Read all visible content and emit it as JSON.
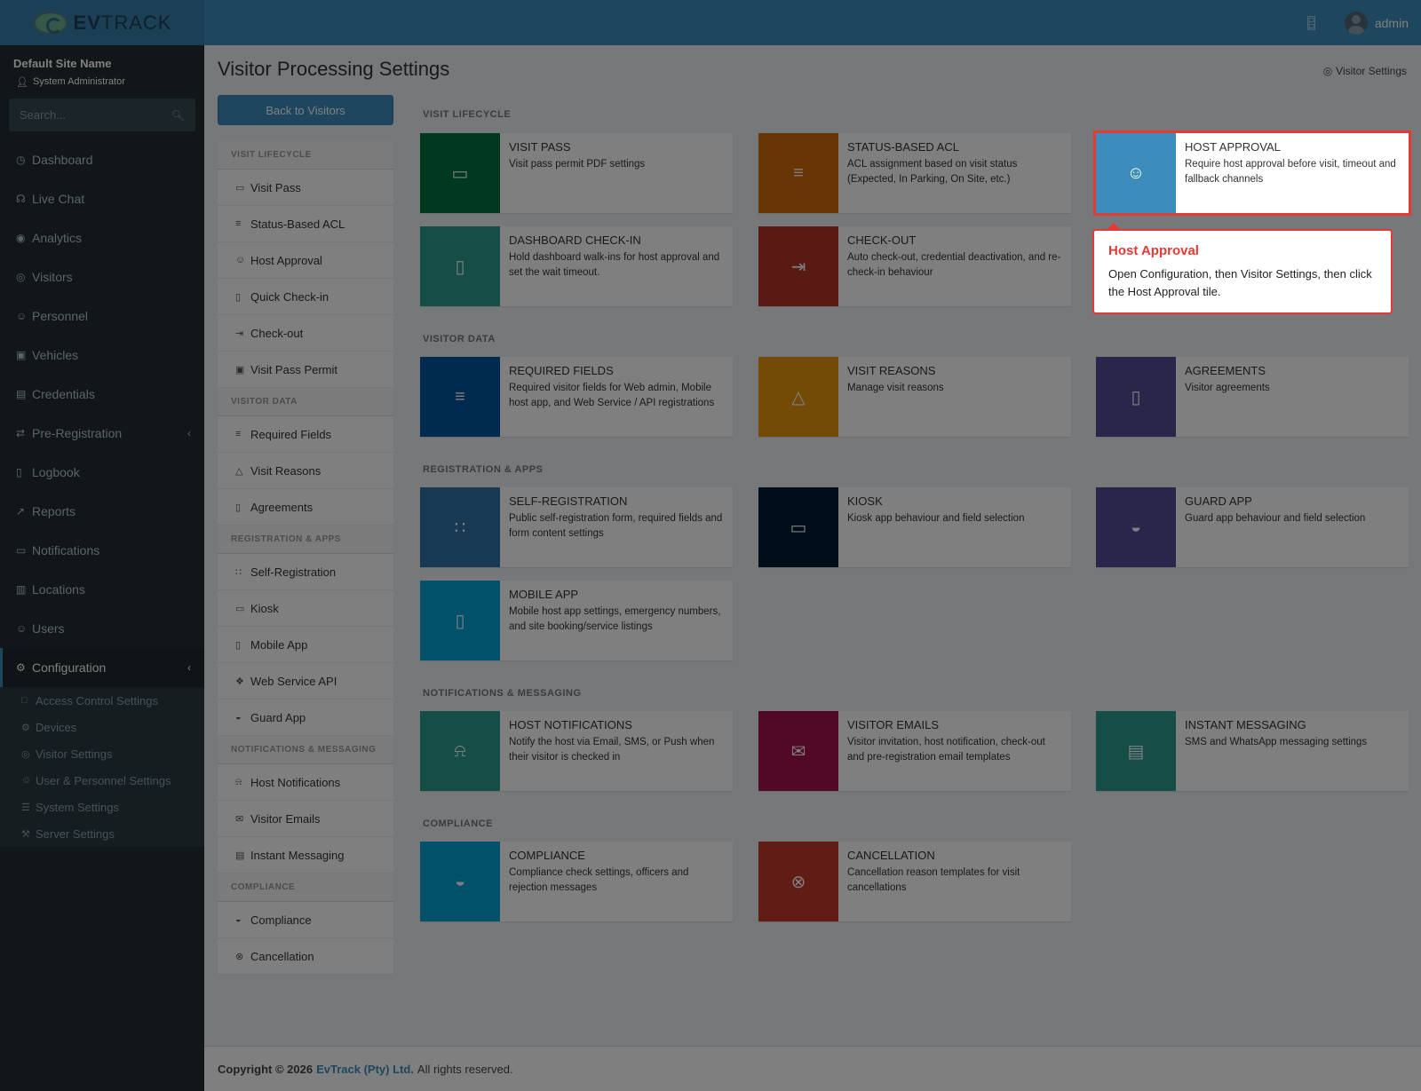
{
  "brand": {
    "logo_text_bold": "EV",
    "logo_text": "TRACK"
  },
  "topbar": {
    "user": "admin",
    "icon_door": "door-icon"
  },
  "sidebar": {
    "site_name": "Default Site Name",
    "role": "System Administrator",
    "search_placeholder": "Search...",
    "items": [
      {
        "label": "Dashboard"
      },
      {
        "label": "Live Chat"
      },
      {
        "label": "Analytics"
      },
      {
        "label": "Visitors"
      },
      {
        "label": "Personnel"
      },
      {
        "label": "Vehicles"
      },
      {
        "label": "Credentials"
      },
      {
        "label": "Pre-Registration"
      },
      {
        "label": "Logbook"
      },
      {
        "label": "Reports"
      },
      {
        "label": "Notifications"
      },
      {
        "label": "Locations"
      },
      {
        "label": "Users"
      },
      {
        "label": "Configuration"
      }
    ],
    "config_sub": [
      {
        "label": "Access Control Settings"
      },
      {
        "label": "Devices"
      },
      {
        "label": "Visitor Settings"
      },
      {
        "label": "User & Personnel Settings"
      },
      {
        "label": "System Settings"
      },
      {
        "label": "Server Settings"
      }
    ]
  },
  "page": {
    "title": "Visitor Processing Settings",
    "breadcrumb": "Visitor Settings",
    "back_button": "Back to Visitors"
  },
  "leftnav": {
    "sections": [
      {
        "title": "VISIT LIFECYCLE",
        "items": [
          "Visit Pass",
          "Status-Based ACL",
          "Host Approval",
          "Quick Check-in",
          "Check-out",
          "Visit Pass Permit"
        ]
      },
      {
        "title": "VISITOR DATA",
        "items": [
          "Required Fields",
          "Visit Reasons",
          "Agreements"
        ]
      },
      {
        "title": "REGISTRATION & APPS",
        "items": [
          "Self-Registration",
          "Kiosk",
          "Mobile App",
          "Web Service API",
          "Guard App"
        ]
      },
      {
        "title": "NOTIFICATIONS & MESSAGING",
        "items": [
          "Host Notifications",
          "Visitor Emails",
          "Instant Messaging"
        ]
      },
      {
        "title": "COMPLIANCE",
        "items": [
          "Compliance",
          "Cancellation"
        ]
      }
    ]
  },
  "sections": {
    "lifecycle": "VISIT LIFECYCLE",
    "data": "VISITOR DATA",
    "apps": "REGISTRATION & APPS",
    "notif": "NOTIFICATIONS & MESSAGING",
    "compliance": "COMPLIANCE"
  },
  "tiles": {
    "visit_pass": {
      "title": "VISIT PASS",
      "desc": "Visit pass permit PDF settings",
      "color": "#00733e"
    },
    "status_acl": {
      "title": "STATUS-BASED ACL",
      "desc": "ACL assignment based on visit status (Expected, In Parking, On Site, etc.)",
      "color": "#d26a0b"
    },
    "host_approval": {
      "title": "HOST APPROVAL",
      "desc": "Require host approval before visit, timeout and fallback channels",
      "color": "#3c8dbc"
    },
    "dash_checkin": {
      "title": "DASHBOARD CHECK-IN",
      "desc": "Hold dashboard walk-ins for host approval and set the wait timeout.",
      "color": "#2a9d8f"
    },
    "checkout": {
      "title": "CHECK-OUT",
      "desc": "Auto check-out, credential deactivation, and re-check-in behaviour",
      "color": "#b33427"
    },
    "required_fields": {
      "title": "REQUIRED FIELDS",
      "desc": "Required visitor fields for Web admin, Mobile host app, and Web Service / API registrations",
      "color": "#00569c"
    },
    "visit_reasons": {
      "title": "VISIT REASONS",
      "desc": "Manage visit reasons",
      "color": "#e6960e"
    },
    "agreements": {
      "title": "AGREEMENTS",
      "desc": "Visitor agreements",
      "color": "#544b97"
    },
    "self_reg": {
      "title": "SELF-REGISTRATION",
      "desc": "Public self-registration form, required fields and form content settings",
      "color": "#2e73a8"
    },
    "kiosk": {
      "title": "KIOSK",
      "desc": "Kiosk app behaviour and field selection",
      "color": "#001a35"
    },
    "guard_app": {
      "title": "GUARD APP",
      "desc": "Guard app behaviour and field selection",
      "color": "#544b97"
    },
    "mobile_app": {
      "title": "MOBILE APP",
      "desc": "Mobile host app settings, emergency numbers, and site booking/service listings",
      "color": "#00a2d3"
    },
    "host_notif": {
      "title": "HOST NOTIFICATIONS",
      "desc": "Notify the host via Email, SMS, or Push when their visitor is checked in",
      "color": "#2a9d8f"
    },
    "visitor_emails": {
      "title": "VISITOR EMAILS",
      "desc": "Visitor invitation, host notification, check-out and pre-registration email templates",
      "color": "#a3124a"
    },
    "instant_msg": {
      "title": "INSTANT MESSAGING",
      "desc": "SMS and WhatsApp messaging settings",
      "color": "#2a9d8f"
    },
    "compliance": {
      "title": "COMPLIANCE",
      "desc": "Compliance check settings, officers and rejection messages",
      "color": "#00a2d3"
    },
    "cancellation": {
      "title": "CANCELLATION",
      "desc": "Cancellation reason templates for visit cancellations",
      "color": "#c0392b"
    }
  },
  "tooltip": {
    "title": "Host Approval",
    "body": "Open Configuration, then Visitor Settings, then click the Host Approval tile."
  },
  "footer": {
    "copyright": "Copyright © 2026",
    "company": "EvTrack (Pty) Ltd.",
    "rights": "All rights reserved."
  }
}
